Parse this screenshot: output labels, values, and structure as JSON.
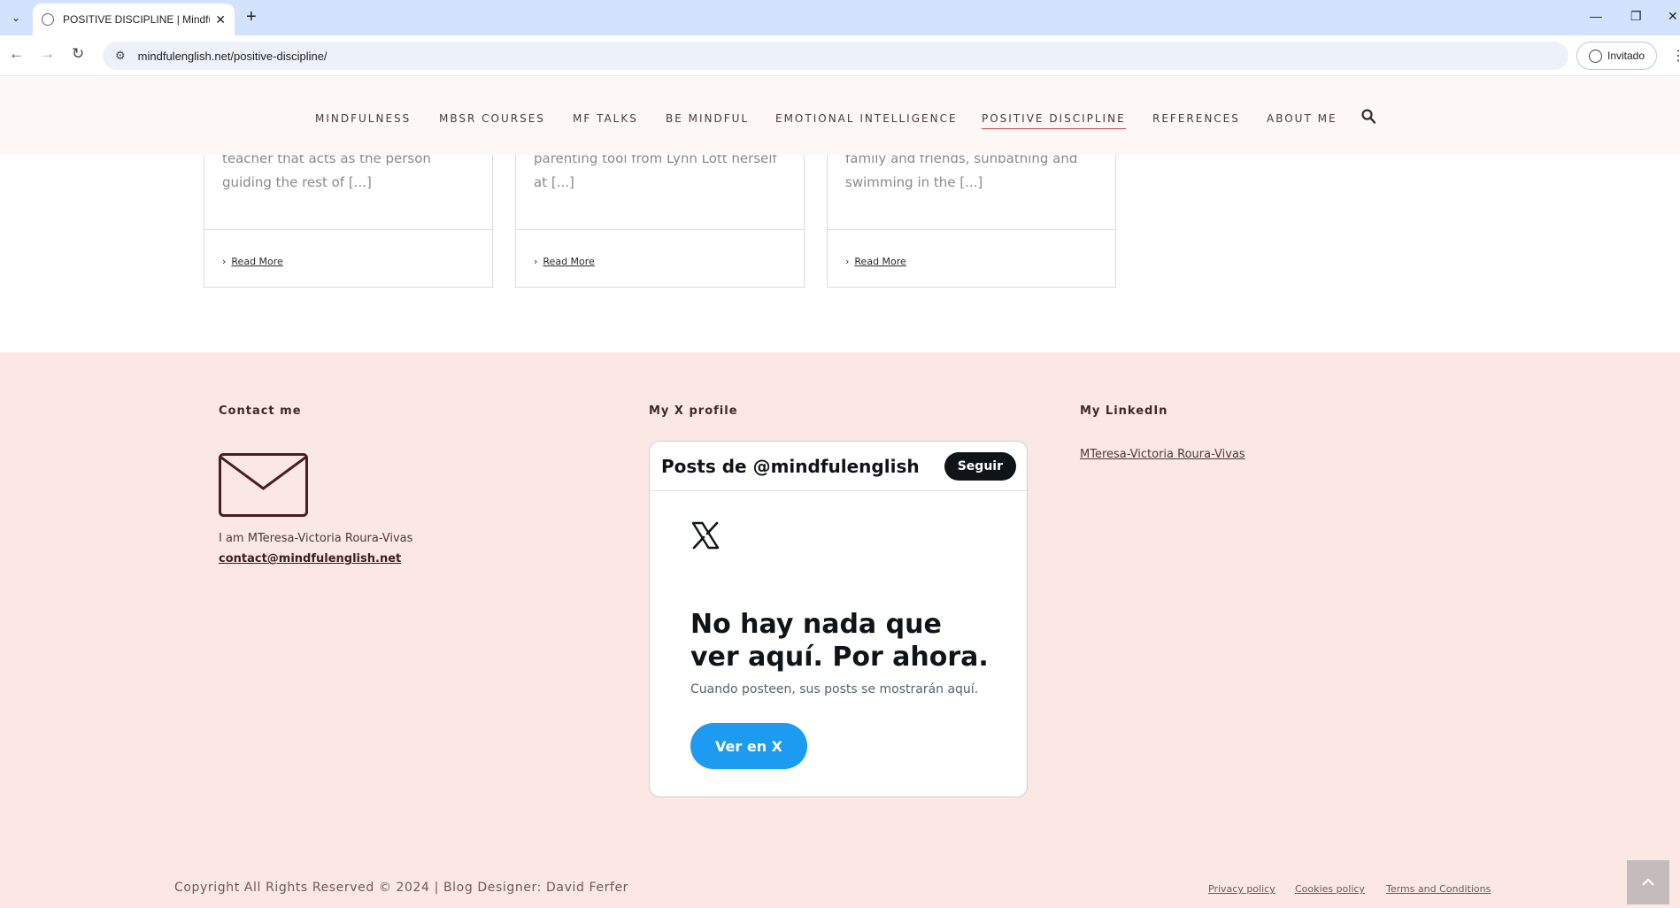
{
  "browser": {
    "tab_title": "POSITIVE DISCIPLINE | Mindfulness",
    "url": "mindfulenglish.net/positive-discipline/",
    "profile_label": "Invitado"
  },
  "nav": {
    "items": [
      "MINDFULNESS",
      "MBSR COURSES",
      "MF TALKS",
      "BE MINDFUL",
      "EMOTIONAL INTELLIGENCE",
      "POSITIVE DISCIPLINE",
      "REFERENCES",
      "ABOUT ME"
    ],
    "active": "POSITIVE DISCIPLINE"
  },
  "cards": [
    {
      "excerpt": "teacher that acts as the person guiding the rest of [...]",
      "more": "Read More"
    },
    {
      "excerpt": "parenting tool from Lynn Lott herself at [...]",
      "more": "Read More"
    },
    {
      "excerpt": "family and friends, sunbathing and swimming in the [...]",
      "more": "Read More"
    }
  ],
  "footer": {
    "contact": {
      "heading": "Contact me",
      "text": "I am MTeresa-Victoria Roura-Vivas",
      "email": "contact@mindfulenglish.net"
    },
    "x_profile": {
      "heading": "My X profile",
      "widget_title": "Posts de @mindfulenglish",
      "follow_label": "Seguir",
      "empty_title": "No hay nada que ver aquí. Por ahora.",
      "empty_sub": "Cuando posteen, sus posts se mostrarán aquí.",
      "view_label": "Ver en X"
    },
    "linkedin": {
      "heading": "My LinkedIn",
      "link": "MTeresa-Victoria Roura-Vivas"
    },
    "copyright": "Copyright All Rights Reserved © 2024 | Blog Designer: David Ferfer",
    "links": [
      "Privacy policy",
      "Cookies policy",
      "Terms and Conditions"
    ]
  }
}
